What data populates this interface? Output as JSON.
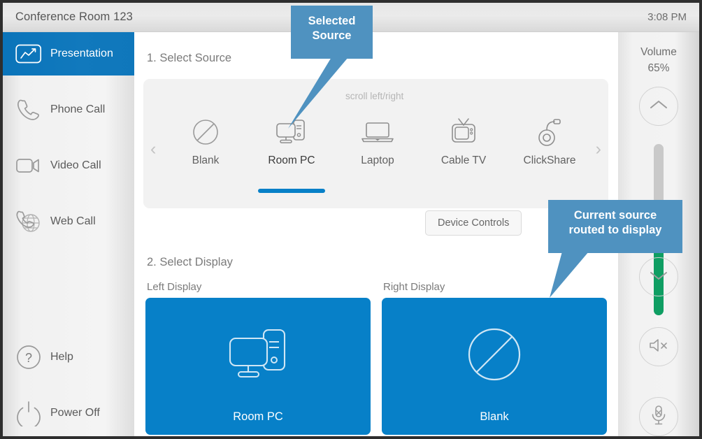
{
  "header": {
    "room_title": "Conference Room 123",
    "clock": "3:08 PM"
  },
  "sidebar": {
    "items": [
      {
        "label": "Presentation",
        "icon": "presentation-icon",
        "active": true
      },
      {
        "label": "Phone Call",
        "icon": "phone-icon",
        "active": false
      },
      {
        "label": "Video Call",
        "icon": "video-camera-icon",
        "active": false
      },
      {
        "label": "Web Call",
        "icon": "web-call-icon",
        "active": false
      },
      {
        "label": "Help",
        "icon": "help-icon",
        "active": false
      },
      {
        "label": "Power Off",
        "icon": "power-icon",
        "active": false
      }
    ]
  },
  "main": {
    "step1_title": "1. Select Source",
    "scroll_hint": "scroll left/right",
    "sources": [
      {
        "label": "Blank",
        "icon": "blank-slash-icon",
        "selected": false
      },
      {
        "label": "Room PC",
        "icon": "desktop-pc-icon",
        "selected": true
      },
      {
        "label": "Laptop",
        "icon": "laptop-icon",
        "selected": false
      },
      {
        "label": "Cable TV",
        "icon": "tv-icon",
        "selected": false
      },
      {
        "label": "ClickShare",
        "icon": "clickshare-icon",
        "selected": false
      }
    ],
    "scroll_left": "‹",
    "scroll_right": "›",
    "device_controls_label": "Device Controls",
    "step2_title": "2. Select Display",
    "displays": [
      {
        "label": "Left Display",
        "source": "Room PC",
        "icon": "desktop-pc-icon"
      },
      {
        "label": "Right Display",
        "source": "Blank",
        "icon": "blank-slash-icon"
      }
    ]
  },
  "volume": {
    "title": "Volume",
    "percent_label": "65%",
    "percent_value": 65,
    "up_icon": "chevron-up-icon",
    "down_icon": "chevron-down-icon",
    "mute_speaker_icon": "speaker-mute-icon",
    "mute_mic_icon": "microphone-mute-icon"
  },
  "callouts": [
    {
      "line1": "Selected",
      "line2": "Source"
    },
    {
      "line1": "Current source",
      "line2": "routed to display"
    }
  ],
  "colors": {
    "accent_blue": "#0780c8",
    "sidebar_active_blue": "#0a74ba",
    "callout_blue": "#4f92c0",
    "volume_green": "#0f9e63"
  }
}
